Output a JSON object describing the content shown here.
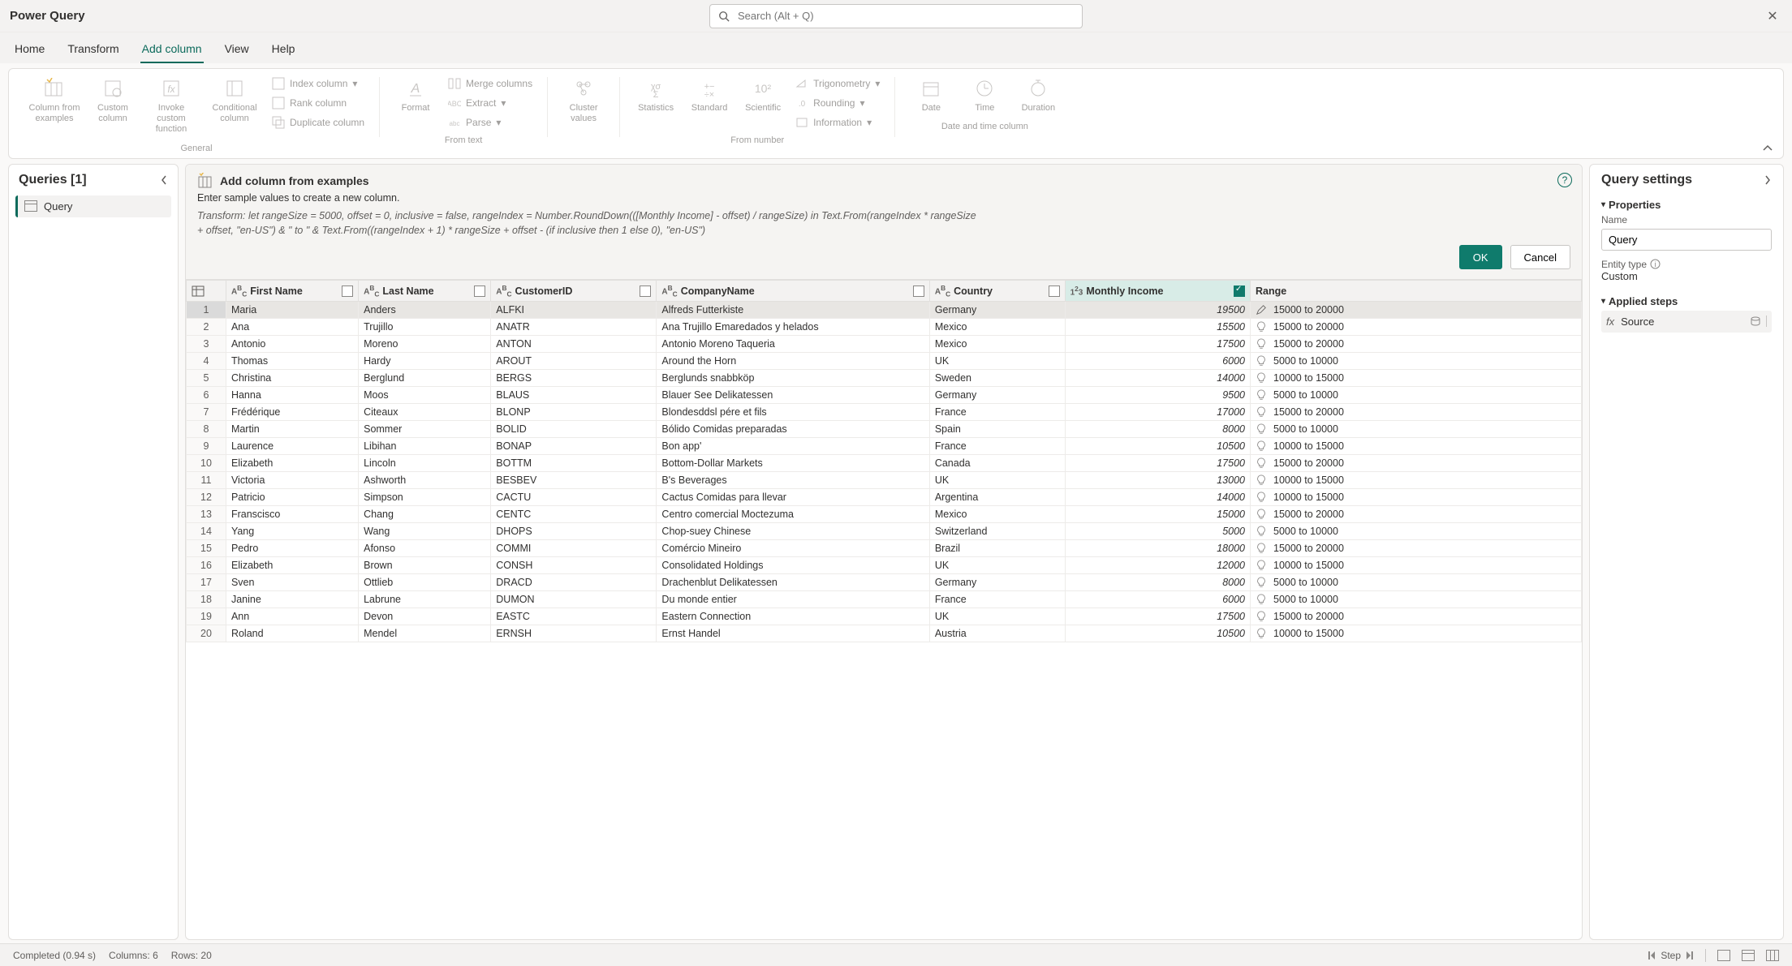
{
  "title": "Power Query",
  "search_placeholder": "Search (Alt + Q)",
  "tabs": [
    "Home",
    "Transform",
    "Add column",
    "View",
    "Help"
  ],
  "active_tab": "Add column",
  "ribbon": {
    "groups": {
      "general": {
        "label": "General",
        "col_from_examples": "Column from examples",
        "custom_column": "Custom column",
        "invoke_custom_function": "Invoke custom function",
        "conditional_column": "Conditional column",
        "index_column": "Index column",
        "rank_column": "Rank column",
        "duplicate_column": "Duplicate column"
      },
      "from_text": {
        "label": "From text",
        "format": "Format",
        "merge_columns": "Merge columns",
        "extract": "Extract",
        "parse": "Parse"
      },
      "cluster": {
        "label": "Cluster values"
      },
      "from_number": {
        "label": "From number",
        "statistics": "Statistics",
        "standard": "Standard",
        "scientific": "Scientific",
        "trigonometry": "Trigonometry",
        "rounding": "Rounding",
        "information": "Information"
      },
      "date_time": {
        "label": "Date and time column",
        "date": "Date",
        "time": "Time",
        "duration": "Duration"
      }
    }
  },
  "queries_panel": {
    "heading": "Queries [1]",
    "item": "Query"
  },
  "banner": {
    "title": "Add column from examples",
    "subtitle": "Enter sample values to create a new column.",
    "formula": "Transform: let rangeSize = 5000, offset = 0, inclusive = false, rangeIndex = Number.RoundDown(([Monthly Income] - offset) / rangeSize) in Text.From(rangeIndex * rangeSize + offset, \"en-US\") & \" to \" & Text.From((rangeIndex + 1) * rangeSize + offset - (if inclusive then 1 else 0), \"en-US\")",
    "ok": "OK",
    "cancel": "Cancel"
  },
  "columns": {
    "first_name": "First Name",
    "last_name": "Last Name",
    "customer_id": "CustomerID",
    "company_name": "CompanyName",
    "country": "Country",
    "monthly_income": "Monthly Income",
    "range": "Range"
  },
  "rows": [
    {
      "n": 1,
      "first": "Maria",
      "last": "Anders",
      "cid": "ALFKI",
      "company": "Alfreds Futterkiste",
      "country": "Germany",
      "income": "19500",
      "range": "15000 to 20000",
      "edit": true
    },
    {
      "n": 2,
      "first": "Ana",
      "last": "Trujillo",
      "cid": "ANATR",
      "company": "Ana Trujillo Emaredados y helados",
      "country": "Mexico",
      "income": "15500",
      "range": "15000 to 20000"
    },
    {
      "n": 3,
      "first": "Antonio",
      "last": "Moreno",
      "cid": "ANTON",
      "company": "Antonio Moreno Taqueria",
      "country": "Mexico",
      "income": "17500",
      "range": "15000 to 20000"
    },
    {
      "n": 4,
      "first": "Thomas",
      "last": "Hardy",
      "cid": "AROUT",
      "company": "Around the Horn",
      "country": "UK",
      "income": "6000",
      "range": "5000 to 10000"
    },
    {
      "n": 5,
      "first": "Christina",
      "last": "Berglund",
      "cid": "BERGS",
      "company": "Berglunds snabbköp",
      "country": "Sweden",
      "income": "14000",
      "range": "10000 to 15000"
    },
    {
      "n": 6,
      "first": "Hanna",
      "last": "Moos",
      "cid": "BLAUS",
      "company": "Blauer See Delikatessen",
      "country": "Germany",
      "income": "9500",
      "range": "5000 to 10000"
    },
    {
      "n": 7,
      "first": "Frédérique",
      "last": "Citeaux",
      "cid": "BLONP",
      "company": "Blondesddsl pére et fils",
      "country": "France",
      "income": "17000",
      "range": "15000 to 20000"
    },
    {
      "n": 8,
      "first": "Martin",
      "last": "Sommer",
      "cid": "BOLID",
      "company": "Bólido Comidas preparadas",
      "country": "Spain",
      "income": "8000",
      "range": "5000 to 10000"
    },
    {
      "n": 9,
      "first": "Laurence",
      "last": "Libihan",
      "cid": "BONAP",
      "company": "Bon app'",
      "country": "France",
      "income": "10500",
      "range": "10000 to 15000"
    },
    {
      "n": 10,
      "first": "Elizabeth",
      "last": "Lincoln",
      "cid": "BOTTM",
      "company": "Bottom-Dollar Markets",
      "country": "Canada",
      "income": "17500",
      "range": "15000 to 20000"
    },
    {
      "n": 11,
      "first": "Victoria",
      "last": "Ashworth",
      "cid": "BESBEV",
      "company": "B's Beverages",
      "country": "UK",
      "income": "13000",
      "range": "10000 to 15000"
    },
    {
      "n": 12,
      "first": "Patricio",
      "last": "Simpson",
      "cid": "CACTU",
      "company": "Cactus Comidas para llevar",
      "country": "Argentina",
      "income": "14000",
      "range": "10000 to 15000"
    },
    {
      "n": 13,
      "first": "Franscisco",
      "last": "Chang",
      "cid": "CENTC",
      "company": "Centro comercial Moctezuma",
      "country": "Mexico",
      "income": "15000",
      "range": "15000 to 20000"
    },
    {
      "n": 14,
      "first": "Yang",
      "last": "Wang",
      "cid": "DHOPS",
      "company": "Chop-suey Chinese",
      "country": "Switzerland",
      "income": "5000",
      "range": "5000 to 10000"
    },
    {
      "n": 15,
      "first": "Pedro",
      "last": "Afonso",
      "cid": "COMMI",
      "company": "Comércio Mineiro",
      "country": "Brazil",
      "income": "18000",
      "range": "15000 to 20000"
    },
    {
      "n": 16,
      "first": "Elizabeth",
      "last": "Brown",
      "cid": "CONSH",
      "company": "Consolidated Holdings",
      "country": "UK",
      "income": "12000",
      "range": "10000 to 15000"
    },
    {
      "n": 17,
      "first": "Sven",
      "last": "Ottlieb",
      "cid": "DRACD",
      "company": "Drachenblut Delikatessen",
      "country": "Germany",
      "income": "8000",
      "range": "5000 to 10000"
    },
    {
      "n": 18,
      "first": "Janine",
      "last": "Labrune",
      "cid": "DUMON",
      "company": "Du monde entier",
      "country": "France",
      "income": "6000",
      "range": "5000 to 10000"
    },
    {
      "n": 19,
      "first": "Ann",
      "last": "Devon",
      "cid": "EASTC",
      "company": "Eastern Connection",
      "country": "UK",
      "income": "17500",
      "range": "15000 to 20000"
    },
    {
      "n": 20,
      "first": "Roland",
      "last": "Mendel",
      "cid": "ERNSH",
      "company": "Ernst Handel",
      "country": "Austria",
      "income": "10500",
      "range": "10000 to 15000"
    }
  ],
  "settings": {
    "heading": "Query settings",
    "properties": "Properties",
    "name_label": "Name",
    "name_value": "Query",
    "entity_type_label": "Entity type",
    "entity_type_value": "Custom",
    "applied_steps": "Applied steps",
    "step_source": "Source"
  },
  "status": {
    "completed": "Completed (0.94 s)",
    "columns": "Columns: 6",
    "rows": "Rows: 20",
    "step_label": "Step"
  }
}
